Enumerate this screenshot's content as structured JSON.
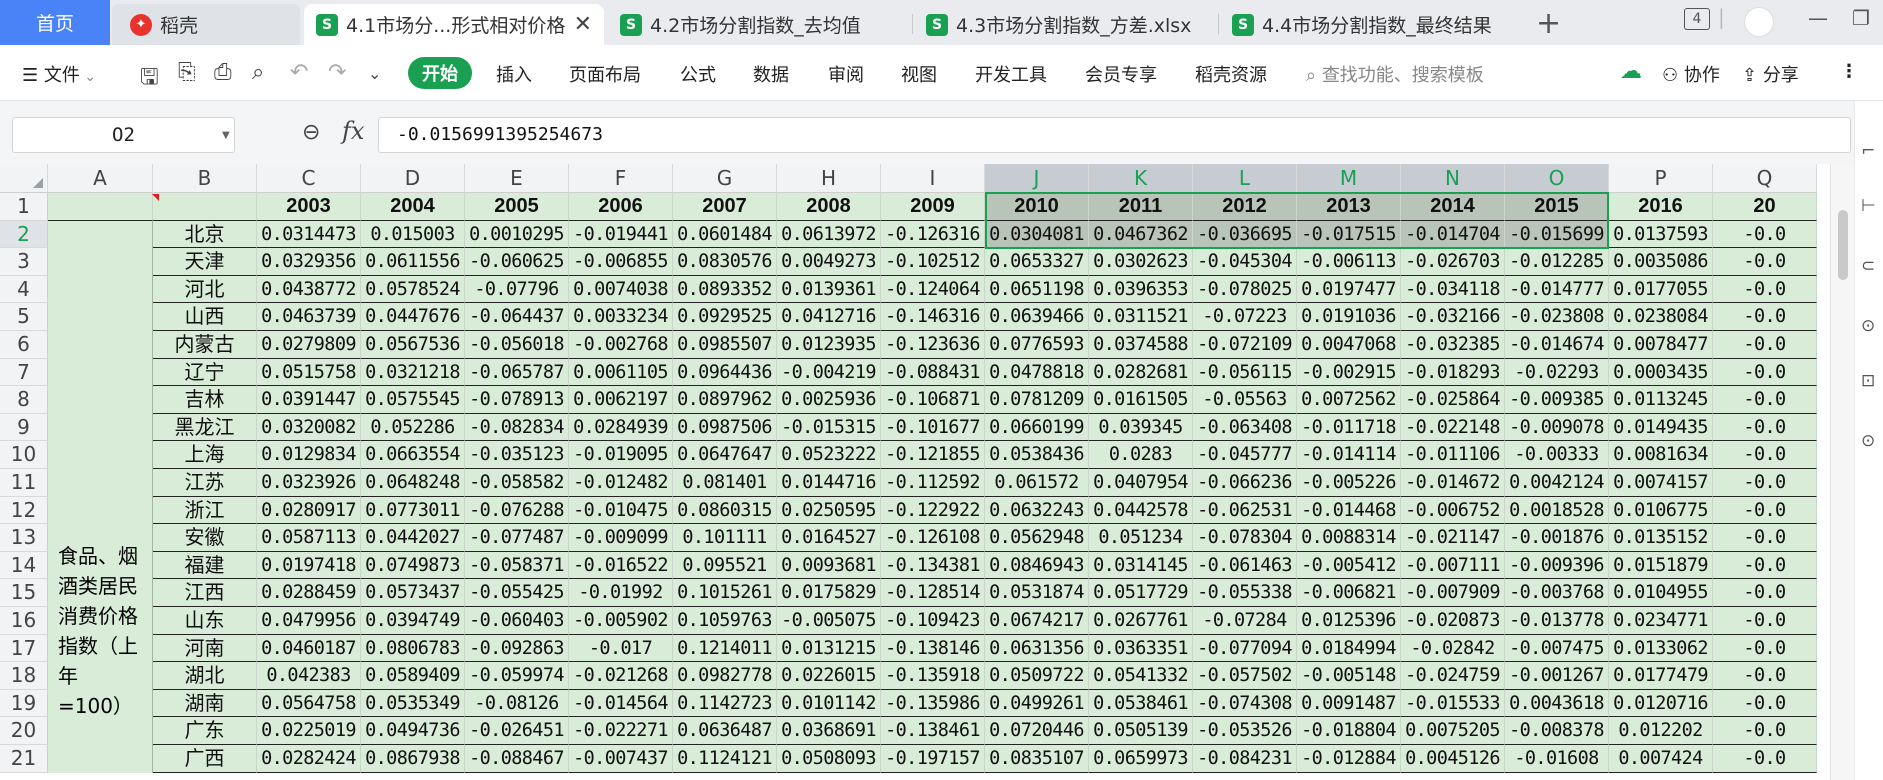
{
  "tabs": {
    "home": "首页",
    "docer": "稻壳",
    "active": "4.1市场分...形式相对价格",
    "t2": "4.2市场分割指数_去均值",
    "t3": "4.3市场分割指数_方差.xlsx",
    "t4": "4.4市场分割指数_最终结果",
    "window_count": "4"
  },
  "menu": {
    "file": "文件",
    "start": "开始",
    "items": [
      "插入",
      "页面布局",
      "公式",
      "数据",
      "审阅",
      "视图",
      "开发工具",
      "会员专享",
      "稻壳资源"
    ],
    "search": "查找功能、搜索模板",
    "collab": "协作",
    "share": "分享"
  },
  "formula": {
    "cell_ref": "O2",
    "value": "-0.0156991395254673"
  },
  "sheet": {
    "columns": [
      "A",
      "B",
      "C",
      "D",
      "E",
      "F",
      "G",
      "H",
      "I",
      "J",
      "K",
      "L",
      "M",
      "N",
      "O",
      "P",
      "Q"
    ],
    "years": [
      "2003",
      "2004",
      "2005",
      "2006",
      "2007",
      "2008",
      "2009",
      "2010",
      "2011",
      "2012",
      "2013",
      "2014",
      "2015",
      "2016",
      "20"
    ],
    "category": "食品、烟酒类居民消费价格指数（上年=100）",
    "rows": [
      {
        "n": "2",
        "prov": "北京",
        "v": [
          "0.0314473",
          "0.015003",
          "0.0010295",
          "-0.019441",
          "0.0601484",
          "0.0613972",
          "-0.126316",
          "0.0304081",
          "0.0467362",
          "-0.036695",
          "-0.017515",
          "-0.014704",
          "-0.015699",
          "0.0137593",
          "-0.0"
        ]
      },
      {
        "n": "3",
        "prov": "天津",
        "v": [
          "0.0329356",
          "0.0611556",
          "-0.060625",
          "-0.006855",
          "0.0830576",
          "0.0049273",
          "-0.102512",
          "0.0653327",
          "0.0302623",
          "-0.045304",
          "-0.006113",
          "-0.026703",
          "-0.012285",
          "0.0035086",
          "-0.0"
        ]
      },
      {
        "n": "4",
        "prov": "河北",
        "v": [
          "0.0438772",
          "0.0578524",
          "-0.07796",
          "0.0074038",
          "0.0893352",
          "0.0139361",
          "-0.124064",
          "0.0651198",
          "0.0396353",
          "-0.078025",
          "0.0197477",
          "-0.034118",
          "-0.014777",
          "0.0177055",
          "-0.0"
        ]
      },
      {
        "n": "5",
        "prov": "山西",
        "v": [
          "0.0463739",
          "0.0447676",
          "-0.064437",
          "0.0033234",
          "0.0929525",
          "0.0412716",
          "-0.146316",
          "0.0639466",
          "0.0311521",
          "-0.07223",
          "0.0191036",
          "-0.032166",
          "-0.023808",
          "0.0238084",
          "-0.0"
        ]
      },
      {
        "n": "6",
        "prov": "内蒙古",
        "v": [
          "0.0279809",
          "0.0567536",
          "-0.056018",
          "-0.002768",
          "0.0985507",
          "0.0123935",
          "-0.123636",
          "0.0776593",
          "0.0374588",
          "-0.072109",
          "0.0047068",
          "-0.032385",
          "-0.014674",
          "0.0078477",
          "-0.0"
        ]
      },
      {
        "n": "7",
        "prov": "辽宁",
        "v": [
          "0.0515758",
          "0.0321218",
          "-0.065787",
          "0.0061105",
          "0.0964436",
          "-0.004219",
          "-0.088431",
          "0.0478818",
          "0.0282681",
          "-0.056115",
          "-0.002915",
          "-0.018293",
          "-0.02293",
          "0.0003435",
          "-0.0"
        ]
      },
      {
        "n": "8",
        "prov": "吉林",
        "v": [
          "0.0391447",
          "0.0575545",
          "-0.078913",
          "0.0062197",
          "0.0897962",
          "0.0025936",
          "-0.106871",
          "0.0781209",
          "0.0161505",
          "-0.05563",
          "0.0072562",
          "-0.025864",
          "-0.009385",
          "0.0113245",
          "-0.0"
        ]
      },
      {
        "n": "9",
        "prov": "黑龙江",
        "v": [
          "0.0320082",
          "0.052286",
          "-0.082834",
          "0.0284939",
          "0.0987506",
          "-0.015315",
          "-0.101677",
          "0.0660199",
          "0.039345",
          "-0.063408",
          "-0.011718",
          "-0.022148",
          "-0.009078",
          "0.0149435",
          "-0.0"
        ]
      },
      {
        "n": "10",
        "prov": "上海",
        "v": [
          "0.0129834",
          "0.0663554",
          "-0.035123",
          "-0.019095",
          "0.0647647",
          "0.0523222",
          "-0.121855",
          "0.0538436",
          "0.0283",
          "-0.045777",
          "-0.014114",
          "-0.011106",
          "-0.00333",
          "0.0081634",
          "-0.0"
        ]
      },
      {
        "n": "11",
        "prov": "江苏",
        "v": [
          "0.0323926",
          "0.0648248",
          "-0.058582",
          "-0.012482",
          "0.081401",
          "0.0144716",
          "-0.112592",
          "0.061572",
          "0.0407954",
          "-0.066236",
          "-0.005226",
          "-0.014672",
          "0.0042124",
          "0.0074157",
          "-0.0"
        ]
      },
      {
        "n": "12",
        "prov": "浙江",
        "v": [
          "0.0280917",
          "0.0773011",
          "-0.076288",
          "-0.010475",
          "0.0860315",
          "0.0250595",
          "-0.122922",
          "0.0632243",
          "0.0442578",
          "-0.062531",
          "-0.014468",
          "-0.006752",
          "0.0018528",
          "0.0106775",
          "-0.0"
        ]
      },
      {
        "n": "13",
        "prov": "安徽",
        "v": [
          "0.0587113",
          "0.0442027",
          "-0.077487",
          "-0.009099",
          "0.101111",
          "0.0164527",
          "-0.126108",
          "0.0562948",
          "0.051234",
          "-0.078304",
          "0.0088314",
          "-0.021147",
          "-0.001876",
          "0.0135152",
          "-0.0"
        ]
      },
      {
        "n": "14",
        "prov": "福建",
        "v": [
          "0.0197418",
          "0.0749873",
          "-0.058371",
          "-0.016522",
          "0.095521",
          "0.0093681",
          "-0.134381",
          "0.0846943",
          "0.0314145",
          "-0.061463",
          "-0.005412",
          "-0.007111",
          "-0.009396",
          "0.0151879",
          "-0.0"
        ]
      },
      {
        "n": "15",
        "prov": "江西",
        "v": [
          "0.0288459",
          "0.0573437",
          "-0.055425",
          "-0.01992",
          "0.1015261",
          "0.0175829",
          "-0.128514",
          "0.0531874",
          "0.0517729",
          "-0.055338",
          "-0.006821",
          "-0.007909",
          "-0.003768",
          "0.0104955",
          "-0.0"
        ]
      },
      {
        "n": "16",
        "prov": "山东",
        "v": [
          "0.0479956",
          "0.0394749",
          "-0.060403",
          "-0.005902",
          "0.1059763",
          "-0.005075",
          "-0.109423",
          "0.0674217",
          "0.0267761",
          "-0.07284",
          "0.0125396",
          "-0.020873",
          "-0.013778",
          "0.0234771",
          "-0.0"
        ]
      },
      {
        "n": "17",
        "prov": "河南",
        "v": [
          "0.0460187",
          "0.0806783",
          "-0.092863",
          "-0.017",
          "0.1214011",
          "0.0131215",
          "-0.138146",
          "0.0631356",
          "0.0363351",
          "-0.077094",
          "0.0184994",
          "-0.02842",
          "-0.007475",
          "0.0133062",
          "-0.0"
        ]
      },
      {
        "n": "18",
        "prov": "湖北",
        "v": [
          "0.042383",
          "0.0589409",
          "-0.059974",
          "-0.021268",
          "0.0982778",
          "0.0226015",
          "-0.135918",
          "0.0509722",
          "0.0541332",
          "-0.057502",
          "-0.005148",
          "-0.024759",
          "-0.001267",
          "0.0177479",
          "-0.0"
        ]
      },
      {
        "n": "19",
        "prov": "湖南",
        "v": [
          "0.0564758",
          "0.0535349",
          "-0.08126",
          "-0.014564",
          "0.1142723",
          "0.0101142",
          "-0.135986",
          "0.0499261",
          "0.0538461",
          "-0.074308",
          "0.0091487",
          "-0.015533",
          "0.0043618",
          "0.0120716",
          "-0.0"
        ]
      },
      {
        "n": "20",
        "prov": "广东",
        "v": [
          "0.0225019",
          "0.0494736",
          "-0.026451",
          "-0.022271",
          "0.0636487",
          "0.0368691",
          "-0.138461",
          "0.0720446",
          "0.0505139",
          "-0.053526",
          "-0.018804",
          "0.0075205",
          "-0.008378",
          "0.012202",
          "-0.0"
        ]
      },
      {
        "n": "21",
        "prov": "广西",
        "v": [
          "0.0282424",
          "0.0867938",
          "-0.088467",
          "-0.007437",
          "0.1124121",
          "0.0508093",
          "-0.197157",
          "0.0835107",
          "0.0659973",
          "-0.084231",
          "-0.012884",
          "0.0045126",
          "-0.01608",
          "0.007424",
          "-0.0"
        ]
      }
    ]
  }
}
